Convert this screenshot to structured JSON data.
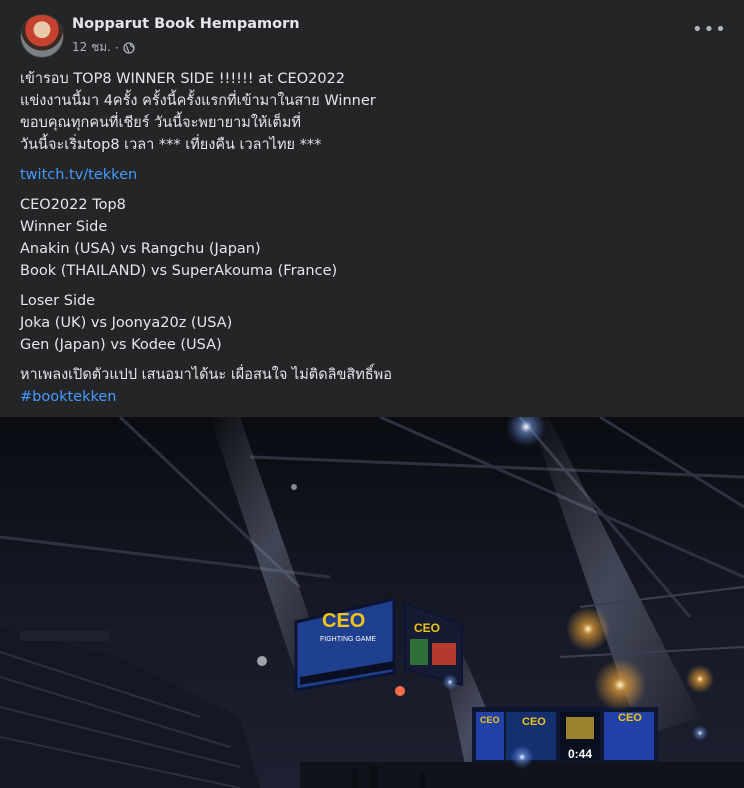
{
  "post": {
    "author": "Nopparut Book Hempamorn",
    "time": "12 ชม.",
    "separator": "·",
    "more_label": "•••",
    "lines": [
      "เข้ารอบ TOP8 WINNER SIDE !!!!!! at CEO2022",
      "แข่งงานนี้มา 4ครั้ง ครั้งนี้ครั้งแรกที่เข้ามาในสาย Winner",
      "ขอบคุณทุกคนที่เชียร์ วันนี้จะพยายามให้เต็มที่",
      "วันนี้จะเริ่มtop8 เวลา *** เที่ยงคืน เวลาไทย ***"
    ],
    "link": "twitch.tv/tekken",
    "bracket": [
      "CEO2022 Top8",
      "Winner Side",
      "Anakin (USA) vs Rangchu (Japan)",
      "Book (THAILAND) vs SuperAkouma (France)"
    ],
    "loser": [
      "Loser Side",
      "Joka (UK) vs Joonya20z (USA)",
      "Gen (Japan) vs Kodee (USA)"
    ],
    "closing": "หาเพลงเปิดตัวแปป เสนอมาได้นะ เผื่อสนใจ ไม่ติดลิขสิทธิ์พอ",
    "hashtag": "#booktekken"
  },
  "photo": {
    "screen_main": "CEO",
    "screen_sub": "FIGHTING GAME",
    "screen_right": "CEO",
    "timer": "0:44",
    "stage_left": "CEO",
    "stage_mid": "CEO",
    "stage_right": "CEO"
  },
  "colors": {
    "background": "#242526",
    "text": "#e4e6eb",
    "secondary": "#b0b3b8",
    "link": "#4599ff"
  },
  "icons": [
    "globe-icon",
    "more-options-icon"
  ]
}
